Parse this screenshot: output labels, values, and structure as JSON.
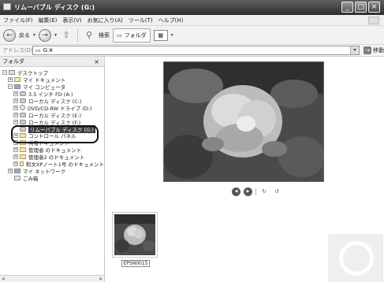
{
  "window": {
    "title": "リムーバブル ディスク (G:)",
    "buttons": {
      "minimize": "_",
      "maximize": "□",
      "close": "×"
    }
  },
  "menu": [
    "ファイル(F)",
    "編集(E)",
    "表示(V)",
    "お気に入り(A)",
    "ツール(T)",
    "ヘルプ(H)"
  ],
  "toolbar": {
    "back_label": "戻る",
    "search_label": "検索",
    "folders_label": "フォルダ"
  },
  "address": {
    "label": "アドレス(D)",
    "value": "G:¥",
    "go_label": "移動"
  },
  "folder_pane": {
    "header": "フォルダ",
    "close": "×",
    "items": [
      {
        "label": "デスクトップ",
        "icon": "desktop-icon",
        "expander": "−"
      },
      {
        "label": "マイ ドキュメント",
        "icon": "folder-icon",
        "expander": "+"
      },
      {
        "label": "マイ コンピュータ",
        "icon": "computer-icon",
        "expander": "−"
      },
      {
        "label": "3.5 インチ FD (A:)",
        "icon": "floppy-icon",
        "expander": "+"
      },
      {
        "label": "ローカル ディスク (C:)",
        "icon": "drive-icon",
        "expander": "+"
      },
      {
        "label": "DVD/CD-RW ドライブ (D:)",
        "icon": "cd-icon",
        "expander": "+"
      },
      {
        "label": "ローカル ディスク (E:)",
        "icon": "drive-icon",
        "expander": "+"
      },
      {
        "label": "ローカル ディスク (F:)",
        "icon": "drive-icon",
        "expander": "+"
      },
      {
        "label": "リムーバブル ディスク (G:)",
        "icon": "removable-drive-icon",
        "expander": ""
      },
      {
        "label": "コントロール パネル",
        "icon": "control-panel-icon",
        "expander": "+"
      },
      {
        "label": "共有ドキュメント",
        "icon": "folder-icon",
        "expander": "+"
      },
      {
        "label": "管理者 のドキュメント",
        "icon": "folder-icon",
        "expander": "+"
      },
      {
        "label": "管理者2 のドキュメント",
        "icon": "folder-icon",
        "expander": "+"
      },
      {
        "label": "和文XPノート1号 のドキュメント",
        "icon": "folder-icon",
        "expander": "+"
      },
      {
        "label": "マイ ネットワーク",
        "icon": "network-icon",
        "expander": "+"
      },
      {
        "label": "ごみ箱",
        "icon": "recycle-bin-icon",
        "expander": ""
      }
    ],
    "selected_index": 8
  },
  "content": {
    "thumbnail_name": "EPSN0015",
    "viewer_controls": [
      "previous-icon",
      "next-icon",
      "rotate-cw-icon",
      "rotate-ccw-icon"
    ]
  },
  "colors": {
    "titlebar": "#3a3a3a",
    "selection": "#3c3c3c",
    "photo_dark": "#3b3b3b",
    "photo_light": "#d8d8d8"
  }
}
